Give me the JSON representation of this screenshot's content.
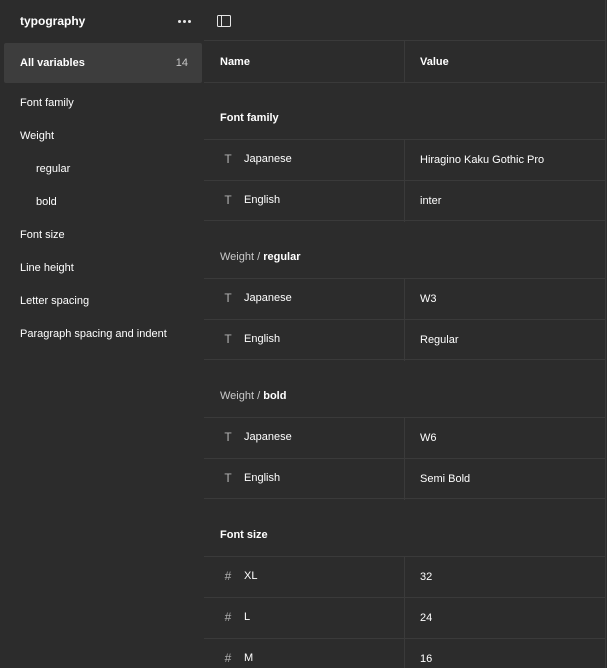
{
  "sidebar": {
    "collection_title": "typography",
    "all_variables": {
      "label": "All variables",
      "count": "14"
    },
    "groups": [
      {
        "label": "Font family"
      },
      {
        "label": "Weight"
      },
      {
        "label": "regular"
      },
      {
        "label": "bold"
      },
      {
        "label": "Font size"
      },
      {
        "label": "Line height"
      },
      {
        "label": "Letter spacing"
      },
      {
        "label": "Paragraph spacing and indent"
      }
    ]
  },
  "table": {
    "headers": {
      "name": "Name",
      "value": "Value"
    },
    "sections": [
      {
        "title": "Font family",
        "rows": [
          {
            "icon": "text-type-icon",
            "name": "Japanese",
            "value": "Hiragino Kaku Gothic Pro"
          },
          {
            "icon": "text-type-icon",
            "name": "English",
            "value": "inter"
          }
        ]
      },
      {
        "title_prefix": "Weight / ",
        "title_strong": "regular",
        "rows": [
          {
            "icon": "text-type-icon",
            "name": "Japanese",
            "value": "W3"
          },
          {
            "icon": "text-type-icon",
            "name": "English",
            "value": "Regular"
          }
        ]
      },
      {
        "title_prefix": "Weight / ",
        "title_strong": "bold",
        "rows": [
          {
            "icon": "text-type-icon",
            "name": "Japanese",
            "value": "W6"
          },
          {
            "icon": "text-type-icon",
            "name": "English",
            "value": "Semi Bold"
          }
        ]
      },
      {
        "title": "Font size",
        "rows": [
          {
            "icon": "number-type-icon",
            "name": "XL",
            "value": "32"
          },
          {
            "icon": "number-type-icon",
            "name": "L",
            "value": "24"
          },
          {
            "icon": "number-type-icon",
            "name": "M",
            "value": "16"
          }
        ]
      }
    ]
  },
  "colors": {
    "background": "#2c2c2c",
    "selected": "#3d3d3d",
    "divider": "#3a3a3a",
    "text": "#ffffff",
    "muted_text": "#c9c9c9"
  }
}
